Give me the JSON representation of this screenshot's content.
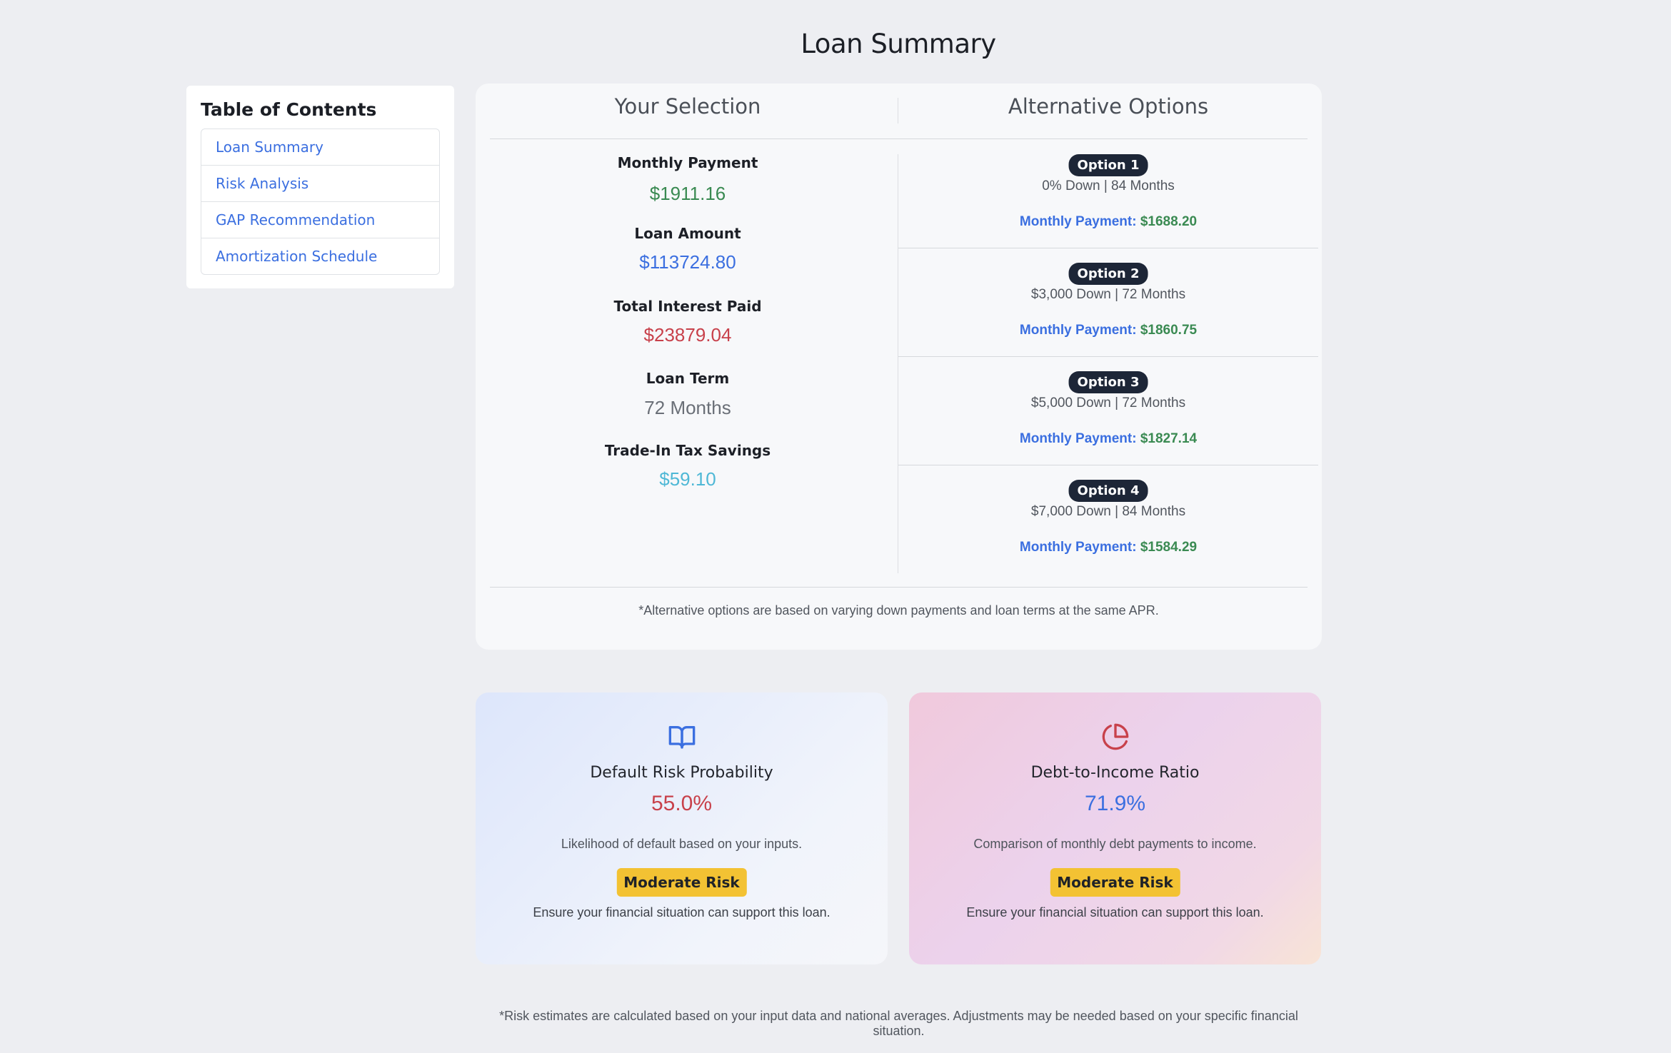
{
  "page": {
    "title": "Loan Summary"
  },
  "toc": {
    "title": "Table of Contents",
    "items": [
      {
        "label": "Loan Summary"
      },
      {
        "label": "Risk Analysis"
      },
      {
        "label": "GAP Recommendation"
      },
      {
        "label": "Amortization Schedule"
      }
    ]
  },
  "summary": {
    "selection_header": "Your Selection",
    "alternatives_header": "Alternative Options",
    "metrics": [
      {
        "label": "Monthly Payment",
        "value": "$1911.16",
        "color": "#3a8a52"
      },
      {
        "label": "Loan Amount",
        "value": "$113724.80",
        "color": "#3b6fe0"
      },
      {
        "label": "Total Interest Paid",
        "value": "$23879.04",
        "color": "#c8414b"
      },
      {
        "label": "Loan Term",
        "value": "72 Months",
        "color": "#6a6f77"
      },
      {
        "label": "Trade-In Tax Savings",
        "value": "$59.10",
        "color": "#4fb8d6"
      }
    ],
    "options": [
      {
        "badge": "Option 1",
        "desc": "0% Down | 84 Months",
        "pay_label": "Monthly Payment:",
        "pay_value": "$1688.20"
      },
      {
        "badge": "Option 2",
        "desc": "$3,000 Down | 72 Months",
        "pay_label": "Monthly Payment:",
        "pay_value": "$1860.75"
      },
      {
        "badge": "Option 3",
        "desc": "$5,000 Down | 72 Months",
        "pay_label": "Monthly Payment:",
        "pay_value": "$1827.14"
      },
      {
        "badge": "Option 4",
        "desc": "$7,000 Down | 84 Months",
        "pay_label": "Monthly Payment:",
        "pay_value": "$1584.29"
      }
    ],
    "note": "*Alternative options are based on varying down payments and loan terms at the same APR."
  },
  "risk": {
    "cards": [
      {
        "icon": "book-icon",
        "title": "Default Risk Probability",
        "value": "55.0%",
        "value_color": "#c8414b",
        "desc": "Likelihood of default based on your inputs.",
        "badge": "Moderate Risk",
        "advice": "Ensure your financial situation can support this loan."
      },
      {
        "icon": "pie-chart-icon",
        "title": "Debt-to-Income Ratio",
        "value": "71.9%",
        "value_color": "#3b6fe0",
        "desc": "Comparison of monthly debt payments to income.",
        "badge": "Moderate Risk",
        "advice": "Ensure your financial situation can support this loan."
      }
    ],
    "note": "*Risk estimates are calculated based on your input data and national averages. Adjustments may be needed based on your specific financial situation."
  },
  "colors": {
    "accent_blue": "#3b6fe0",
    "green": "#3a8a52",
    "red": "#c8414b",
    "badge_dark": "#1d2637",
    "badge_yellow": "#f3c233"
  }
}
